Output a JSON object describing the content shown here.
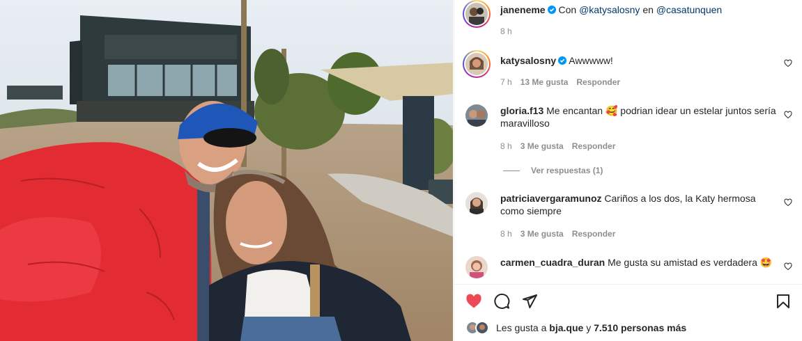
{
  "post": {
    "author": "janeneme",
    "caption_prefix": "Con",
    "caption_mention_1": "@katysalosny",
    "caption_middle": "en",
    "caption_mention_2": "@casatunquen",
    "time": "8 h"
  },
  "comments": [
    {
      "user": "katysalosny",
      "verified": true,
      "text": "Awwwww!",
      "time": "7 h",
      "likes": "13 Me gusta",
      "reply": "Responder"
    },
    {
      "user": "gloria.f13",
      "verified": false,
      "text": "Me encantan 🥰 podrian idear un estelar juntos sería maravilloso",
      "time": "8 h",
      "likes": "3 Me gusta",
      "reply": "Responder"
    },
    {
      "user": "patriciavergaramunoz",
      "verified": false,
      "text": "Cariños a los dos, la Katy hermosa como siempre",
      "time": "8 h",
      "likes": "3 Me gusta",
      "reply": "Responder"
    },
    {
      "user": "carmen_cuadra_duran",
      "verified": false,
      "text": "Me gusta su amistad es verdadera 🤩"
    }
  ],
  "view_replies": "Ver respuestas (1)",
  "footer": {
    "likes_prefix": "Les gusta a",
    "likes_user": "bja.que",
    "likes_middle": "y",
    "likes_count": "7.510 personas más"
  },
  "icons": {
    "like": "heart-filled-icon",
    "comment": "comment-bubble-icon",
    "share": "paper-plane-icon",
    "save": "bookmark-icon"
  },
  "colors": {
    "like_red": "#ed4956",
    "verified_blue": "#0095f6",
    "mention": "#00376b"
  }
}
